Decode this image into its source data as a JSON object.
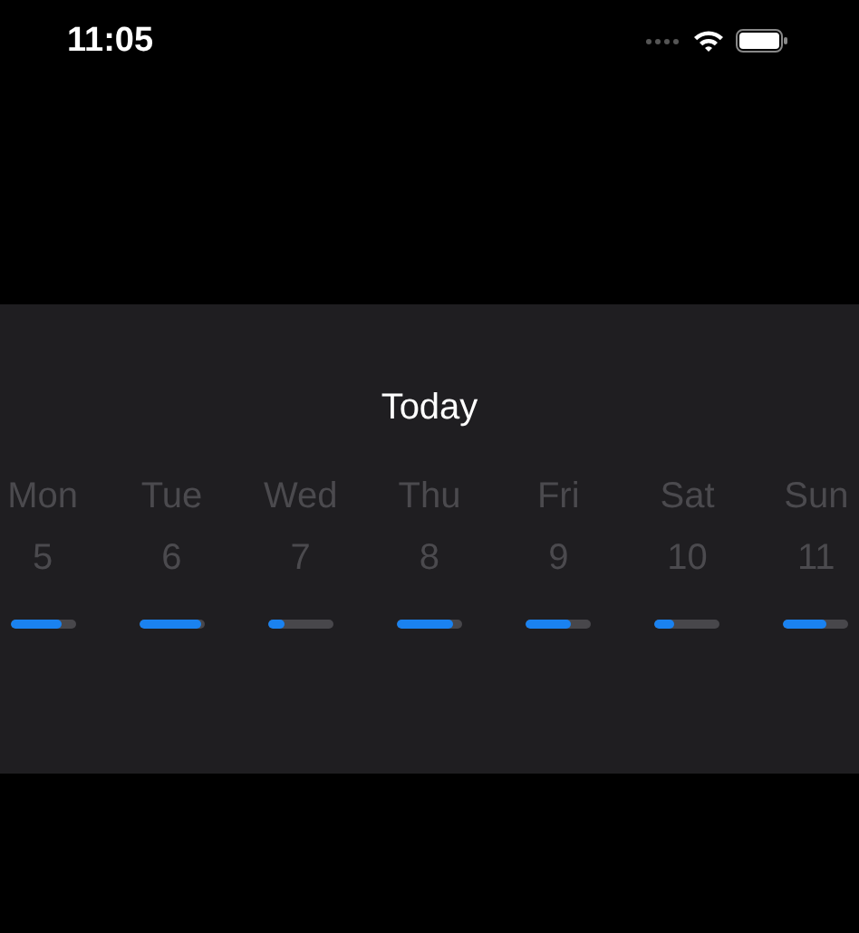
{
  "status_bar": {
    "time": "11:05"
  },
  "title": "Today",
  "days": [
    {
      "name": "Mon",
      "date": "5",
      "level": 0.8
    },
    {
      "name": "Tue",
      "date": "6",
      "level": 0.95
    },
    {
      "name": "Wed",
      "date": "7",
      "level": 0.25
    },
    {
      "name": "Thu",
      "date": "8",
      "level": 0.85
    },
    {
      "name": "Fri",
      "date": "9",
      "level": 0.7
    },
    {
      "name": "Sat",
      "date": "10",
      "level": 0.3
    },
    {
      "name": "Sun",
      "date": "11",
      "level": 0.65
    }
  ]
}
